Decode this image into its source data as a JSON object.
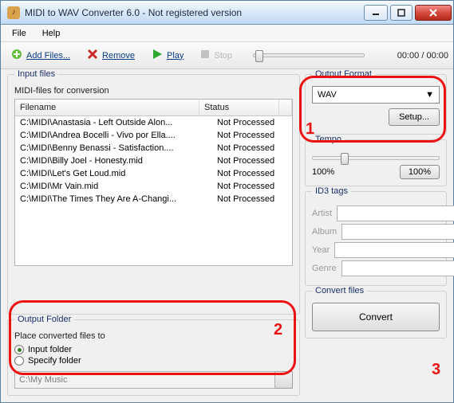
{
  "window": {
    "title": "MIDI to WAV Converter 6.0 - Not registered version"
  },
  "menu": {
    "file": "File",
    "help": "Help"
  },
  "toolbar": {
    "add": "Add Files...",
    "remove": "Remove",
    "play": "Play",
    "stop": "Stop",
    "time": "00:00 / 00:00"
  },
  "input": {
    "group_title": "Input files",
    "subtitle": "MIDI-files for conversion",
    "col_filename": "Filename",
    "col_status": "Status",
    "rows": [
      {
        "file": "C:\\MIDI\\Anastasia - Left Outside Alon...",
        "status": "Not Processed"
      },
      {
        "file": "C:\\MIDI\\Andrea Bocelli - Vivo por Ella....",
        "status": "Not Processed"
      },
      {
        "file": "C:\\MIDI\\Benny Benassi - Satisfaction....",
        "status": "Not Processed"
      },
      {
        "file": "C:\\MIDI\\Billy Joel - Honesty.mid",
        "status": "Not Processed"
      },
      {
        "file": "C:\\MIDI\\Let's Get Loud.mid",
        "status": "Not Processed"
      },
      {
        "file": "C:\\MIDI\\Mr Vain.mid",
        "status": "Not Processed"
      },
      {
        "file": "C:\\MIDI\\The Times They Are A-Changi...",
        "status": "Not Processed"
      }
    ]
  },
  "output_folder": {
    "group_title": "Output Folder",
    "prompt": "Place converted files to",
    "opt_input": "Input folder",
    "opt_specify": "Specify folder",
    "selected": "input",
    "path": "C:\\My Music"
  },
  "output_format": {
    "group_title": "Output Format",
    "selected": "WAV",
    "setup_btn": "Setup..."
  },
  "tempo": {
    "group_title": "Tempo",
    "label": "100%",
    "reset_btn": "100%"
  },
  "id3": {
    "group_title": "ID3 tags",
    "artist_l": "Artist",
    "artist": "",
    "album_l": "Album",
    "album": "",
    "year_l": "Year",
    "year": "",
    "genre_l": "Genre",
    "genre": ""
  },
  "convert": {
    "group_title": "Convert files",
    "btn": "Convert"
  },
  "annotations": {
    "a1": "1",
    "a2": "2",
    "a3": "3"
  }
}
